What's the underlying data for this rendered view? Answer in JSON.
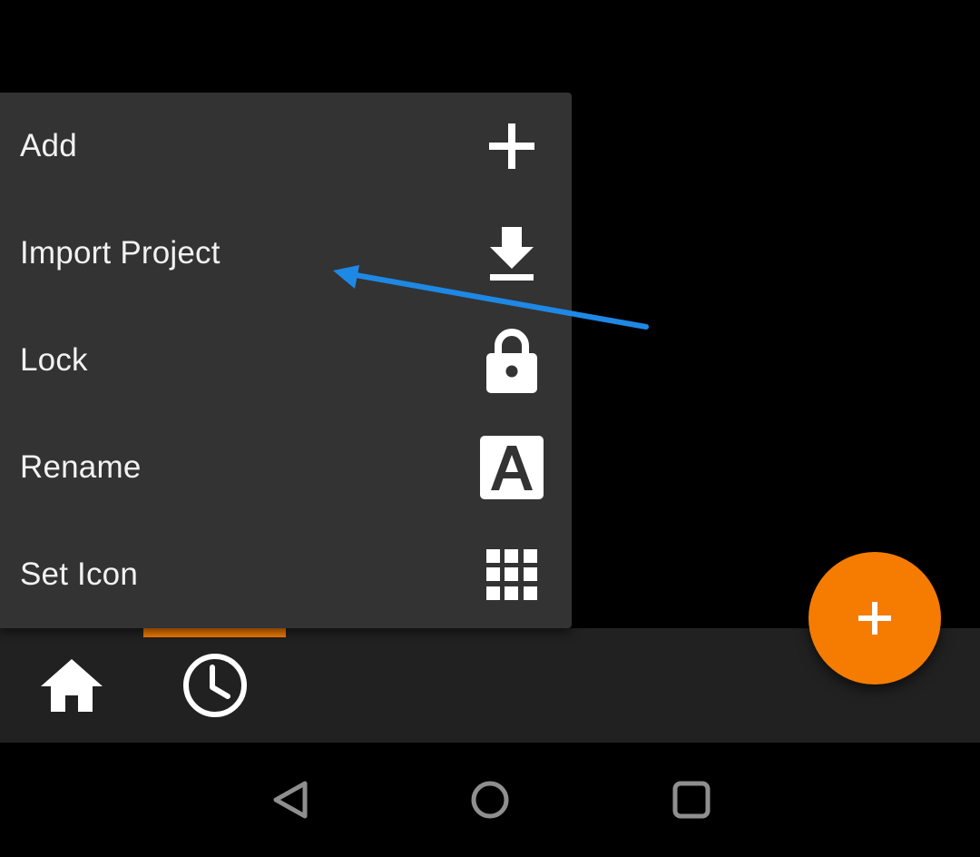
{
  "menu": {
    "items": [
      {
        "label": "Add",
        "icon": "plus-icon"
      },
      {
        "label": "Import Project",
        "icon": "download-icon"
      },
      {
        "label": "Lock",
        "icon": "lock-icon"
      },
      {
        "label": "Rename",
        "icon": "rename-a-icon"
      },
      {
        "label": "Set Icon",
        "icon": "grid-icon"
      }
    ]
  },
  "tabs": [
    {
      "icon": "home-icon",
      "selected": false
    },
    {
      "icon": "clock-icon",
      "selected": true
    }
  ],
  "fab": {
    "icon": "plus-icon"
  },
  "navigation": {
    "buttons": [
      "back-triangle-icon",
      "home-circle-icon",
      "recents-square-icon"
    ]
  },
  "colors": {
    "accent": "#f57c00",
    "menu_background": "#333333",
    "tab_bar_background": "#212121",
    "annotation_arrow": "#1e88e5"
  }
}
